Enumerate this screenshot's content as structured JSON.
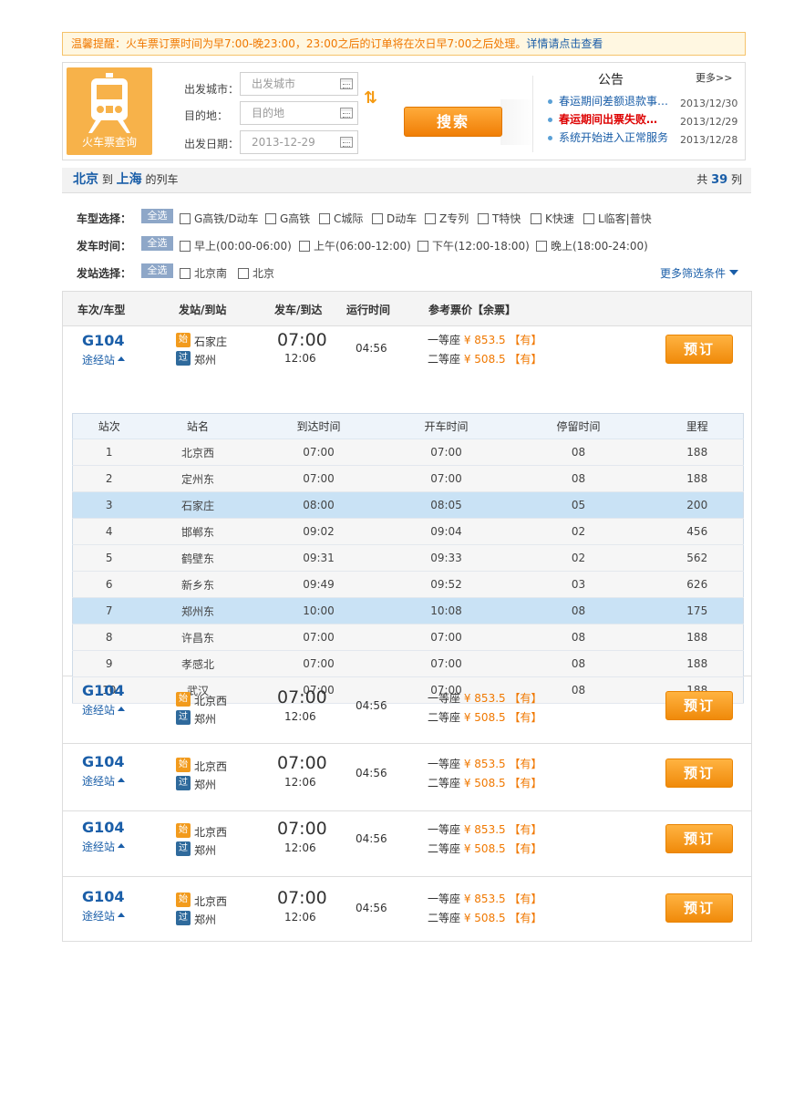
{
  "notice": {
    "label": "温馨提醒：",
    "text": "火车票订票时间为早7:00-晚23:00，23:00之后的订单将在次日早7:00之后处理。",
    "link": "详情请点击查看"
  },
  "logo": {
    "label": "火车票查询"
  },
  "form": {
    "from_label": "出发城市：",
    "from_placeholder": "出发城市",
    "to_label": "目的地：",
    "to_placeholder": "目的地",
    "date_label": "出发日期：",
    "date_value": "2013-12-29",
    "search_label": "搜索"
  },
  "announcements": {
    "title": "公告",
    "more": "更多>>",
    "items": [
      {
        "text": "春运期间差额退款事…",
        "date": "2013/12/30",
        "hot": false
      },
      {
        "text": "春运期间出票失败…",
        "date": "2013/12/29",
        "hot": true
      },
      {
        "text": "系统开始进入正常服务",
        "date": "2013/12/28",
        "hot": false
      }
    ]
  },
  "result": {
    "from": "北京",
    "to_word": "到",
    "to": "上海",
    "suffix": "的列车",
    "count_prefix": "共",
    "count": "39",
    "count_suffix": "列"
  },
  "filters": {
    "all": "全选",
    "type_label": "车型选择：",
    "types": [
      "G高铁/D动车",
      "G高铁",
      "C城际",
      "D动车",
      "Z专列",
      "T特快",
      "K快速",
      "L临客|普快"
    ],
    "time_label": "发车时间：",
    "times": [
      "早上(00:00-06:00)",
      "上午(06:00-12:00)",
      "下午(12:00-18:00)",
      "晚上(18:00-24:00)"
    ],
    "station_label": "发站选择：",
    "stations": [
      "北京南",
      "北京"
    ],
    "more": "更多筛选条件"
  },
  "list_header": {
    "train": "车次/车型",
    "stations": "发站/到站",
    "times": "发车/到达",
    "duration": "运行时间",
    "price": "参考票价【余票】"
  },
  "trains": [
    {
      "code": "G104",
      "via": "途经站",
      "start_badge": "始",
      "start": "石家庄",
      "pass_badge": "过",
      "end": "郑州",
      "dep": "07:00",
      "arr": "12:06",
      "dur": "04:56",
      "seat1": "一等座",
      "price1": "¥ 853.5",
      "avail1": "【有】",
      "seat2": "二等座",
      "price2": "¥ 508.5",
      "avail2": "【有】",
      "book": "预订"
    },
    {
      "code": "G104",
      "via": "途经站",
      "start_badge": "始",
      "start": "北京西",
      "pass_badge": "过",
      "end": "郑州",
      "dep": "07:00",
      "arr": "12:06",
      "dur": "04:56",
      "seat1": "一等座",
      "price1": "¥ 853.5",
      "avail1": "【有】",
      "seat2": "二等座",
      "price2": "¥ 508.5",
      "avail2": "【有】",
      "book": "预订"
    },
    {
      "code": "G104",
      "via": "途经站",
      "start_badge": "始",
      "start": "北京西",
      "pass_badge": "过",
      "end": "郑州",
      "dep": "07:00",
      "arr": "12:06",
      "dur": "04:56",
      "seat1": "一等座",
      "price1": "¥ 853.5",
      "avail1": "【有】",
      "seat2": "二等座",
      "price2": "¥ 508.5",
      "avail2": "【有】",
      "book": "预订"
    },
    {
      "code": "G104",
      "via": "途经站",
      "start_badge": "始",
      "start": "北京西",
      "pass_badge": "过",
      "end": "郑州",
      "dep": "07:00",
      "arr": "12:06",
      "dur": "04:56",
      "seat1": "一等座",
      "price1": "¥ 853.5",
      "avail1": "【有】",
      "seat2": "二等座",
      "price2": "¥ 508.5",
      "avail2": "【有】",
      "book": "预订"
    },
    {
      "code": "G104",
      "via": "途经站",
      "start_badge": "始",
      "start": "北京西",
      "pass_badge": "过",
      "end": "郑州",
      "dep": "07:00",
      "arr": "12:06",
      "dur": "04:56",
      "seat1": "一等座",
      "price1": "¥ 853.5",
      "avail1": "【有】",
      "seat2": "二等座",
      "price2": "¥ 508.5",
      "avail2": "【有】",
      "book": "预订"
    }
  ],
  "stops": {
    "headers": [
      "站次",
      "站名",
      "到达时间",
      "开车时间",
      "停留时间",
      "里程"
    ],
    "rows": [
      {
        "no": "1",
        "name": "北京西",
        "arr": "07:00",
        "dep": "07:00",
        "stay": "08",
        "km": "188",
        "hl": false
      },
      {
        "no": "2",
        "name": "定州东",
        "arr": "07:00",
        "dep": "07:00",
        "stay": "08",
        "km": "188",
        "hl": false
      },
      {
        "no": "3",
        "name": "石家庄",
        "arr": "08:00",
        "dep": "08:05",
        "stay": "05",
        "km": "200",
        "hl": true
      },
      {
        "no": "4",
        "name": "邯郸东",
        "arr": "09:02",
        "dep": "09:04",
        "stay": "02",
        "km": "456",
        "hl": false
      },
      {
        "no": "5",
        "name": "鹤壁东",
        "arr": "09:31",
        "dep": "09:33",
        "stay": "02",
        "km": "562",
        "hl": false
      },
      {
        "no": "6",
        "name": "新乡东",
        "arr": "09:49",
        "dep": "09:52",
        "stay": "03",
        "km": "626",
        "hl": false
      },
      {
        "no": "7",
        "name": "郑州东",
        "arr": "10:00",
        "dep": "10:08",
        "stay": "08",
        "km": "175",
        "hl": true
      },
      {
        "no": "8",
        "name": "许昌东",
        "arr": "07:00",
        "dep": "07:00",
        "stay": "08",
        "km": "188",
        "hl": false
      },
      {
        "no": "9",
        "name": "孝感北",
        "arr": "07:00",
        "dep": "07:00",
        "stay": "08",
        "km": "188",
        "hl": false
      },
      {
        "no": "10",
        "name": "武汉",
        "arr": "07:00",
        "dep": "07:00",
        "stay": "08",
        "km": "188",
        "hl": false
      }
    ]
  },
  "colors": {
    "accent": "#f07800",
    "link": "#1a5ea8",
    "highlight_row": "#c9e2f5"
  }
}
